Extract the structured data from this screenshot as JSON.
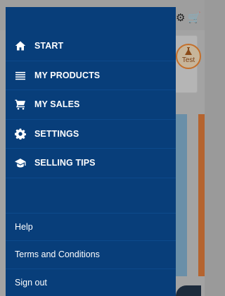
{
  "background": {
    "avatar_label": "Test",
    "icons": {
      "settings": "gear-icon",
      "cart": "cart-icon"
    }
  },
  "drawer": {
    "menu": [
      {
        "label": "START",
        "icon": "home-icon"
      },
      {
        "label": "MY PRODUCTS",
        "icon": "list-icon"
      },
      {
        "label": "MY SALES",
        "icon": "cart-icon"
      },
      {
        "label": "SETTINGS",
        "icon": "gear-icon"
      },
      {
        "label": "SELLING TIPS",
        "icon": "graduation-cap-icon"
      }
    ],
    "links": [
      {
        "label": "Help"
      },
      {
        "label": "Terms and Conditions"
      },
      {
        "label": "Sign out"
      }
    ]
  },
  "colors": {
    "drawer_bg": "#083e7a",
    "divider": "#0d4a8c",
    "accent": "#c46f2a"
  }
}
